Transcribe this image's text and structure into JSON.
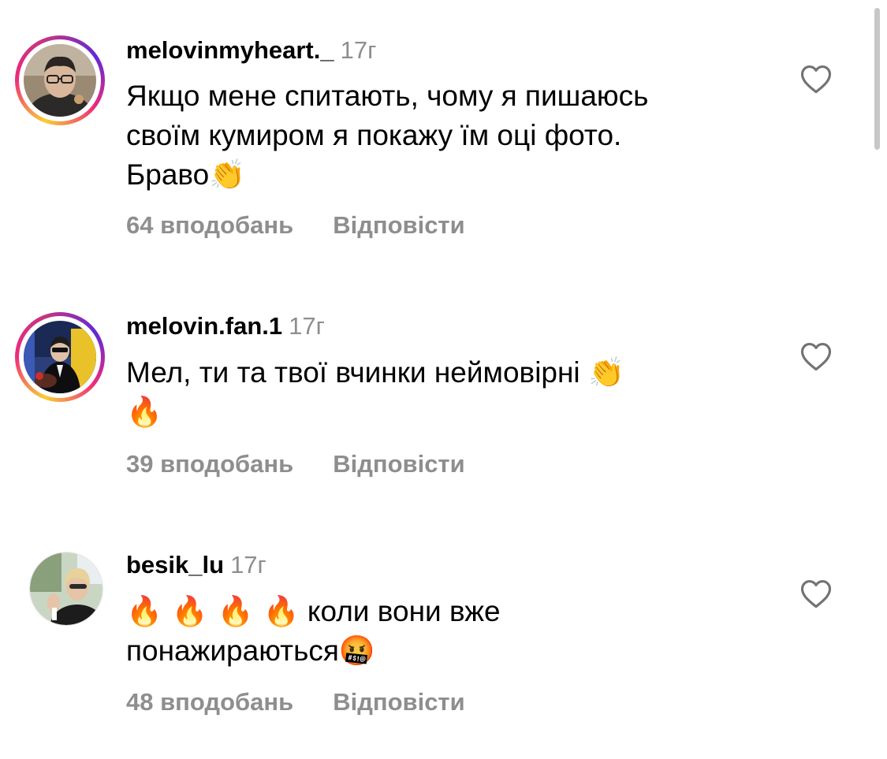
{
  "comments": [
    {
      "username": "melovinmyheart._",
      "time": "17г",
      "lines": [
        "Якщо мене спитають, чому я пишаюсь",
        "своїм кумиром я покажу їм оці фото.",
        "Браво"
      ],
      "emoji": "👏",
      "likes": "64 вподобань",
      "reply": "Відповісти",
      "avatar_icon": "avatar-photo-man-glasses"
    },
    {
      "username": "melovin.fan.1",
      "time": "17г",
      "lines": [
        "Мел, ти та твої вчинки неймовірні"
      ],
      "emoji_inline": "👏",
      "emoji_line2": "🔥",
      "likes": "39 вподобань",
      "reply": "Відповісти",
      "avatar_icon": "avatar-photo-man-suit"
    },
    {
      "username": "besik_lu",
      "time": "17г",
      "emoji_prefix": "🔥 🔥 🔥 🔥",
      "line1_text": "коли вони вже",
      "line2_text": "понажираються",
      "emoji_end": "🤬",
      "likes": "48 вподобань",
      "reply": "Відповісти",
      "avatar_icon": "avatar-photo-woman"
    }
  ],
  "colors": {
    "text": "#000000",
    "secondary": "#8e8e8e",
    "story_ring_start": "#f9ce34",
    "story_ring_mid": "#ee2a7b",
    "story_ring_end": "#6228d7"
  }
}
